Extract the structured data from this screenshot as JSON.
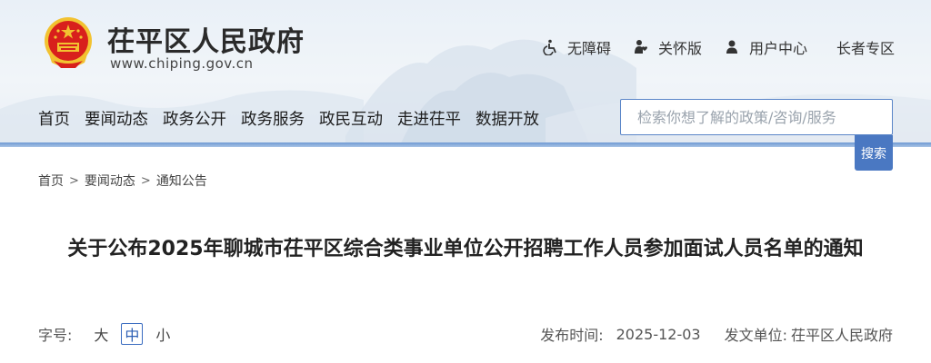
{
  "site": {
    "title": "茌平区人民政府",
    "url": "www.chiping.gov.cn"
  },
  "top_links": [
    {
      "label": "无障碍",
      "icon": "wheelchair-icon"
    },
    {
      "label": "关怀版",
      "icon": "care-icon"
    },
    {
      "label": "用户中心",
      "icon": "user-icon"
    },
    {
      "label": "长者专区",
      "icon": ""
    }
  ],
  "nav": {
    "items": [
      "首页",
      "要闻动态",
      "政务公开",
      "政务服务",
      "政民互动",
      "走进茌平",
      "数据开放"
    ]
  },
  "search": {
    "placeholder": "检索你想了解的政策/咨询/服务",
    "button_label": "搜索"
  },
  "breadcrumb": {
    "items": [
      "首页",
      "要闻动态",
      "通知公告"
    ],
    "separator": ">"
  },
  "article": {
    "title": "关于公布2025年聊城市茌平区综合类事业单位公开招聘工作人员参加面试人员名单的通知"
  },
  "meta": {
    "font_size_label": "字号:",
    "sizes": [
      "大",
      "中",
      "小"
    ],
    "selected_size": "中",
    "publish_time_label": "发布时间:",
    "publish_time": "2025-12-03",
    "publisher_label": "发文单位:",
    "publisher": "茌平区人民政府"
  },
  "colors": {
    "accent": "#4a78c2",
    "header_bg": "#edf2f7",
    "header_border": "#6e99d3",
    "emblem_red": "#d8201c",
    "emblem_gold": "#f2c230"
  }
}
